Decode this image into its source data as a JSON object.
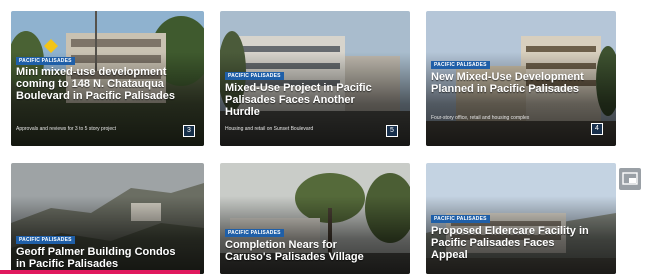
{
  "cards": [
    {
      "tag": "PACIFIC PALISADES",
      "title": "Mini mixed-use development coming to 148 N. Chatauqua Boulevard in Pacific Palisades",
      "subtitle": "Approvals and reviews for 3 to 5 story project",
      "badge": "3"
    },
    {
      "tag": "PACIFIC PALISADES",
      "title": "Mixed-Use Project in Pacific Palisades Faces Another Hurdle",
      "subtitle": "Housing and retail on Sunset Boulevard",
      "badge": "5"
    },
    {
      "tag": "PACIFIC PALISADES",
      "title": "New Mixed-Use Development Planned in Pacific Palisades",
      "subtitle": "Four-story office, retail and housing complex",
      "badge": "4"
    },
    {
      "tag": "PACIFIC PALISADES",
      "title": "Geoff Palmer Building Condos in Pacific Palisades",
      "subtitle": "",
      "badge": ""
    },
    {
      "tag": "PACIFIC PALISADES",
      "title": "Completion Nears for Caruso's Palisades Village",
      "subtitle": "",
      "badge": ""
    },
    {
      "tag": "PACIFIC PALISADES",
      "title": "Proposed Eldercare Facility in Pacific Palisades Faces Appeal",
      "subtitle": "",
      "badge": ""
    }
  ],
  "side_button_icon": "picture-in-picture-icon",
  "colors": {
    "tag_bg": "#1f5fa8",
    "progress": "#e0195e"
  },
  "progress_fraction": 0.31
}
